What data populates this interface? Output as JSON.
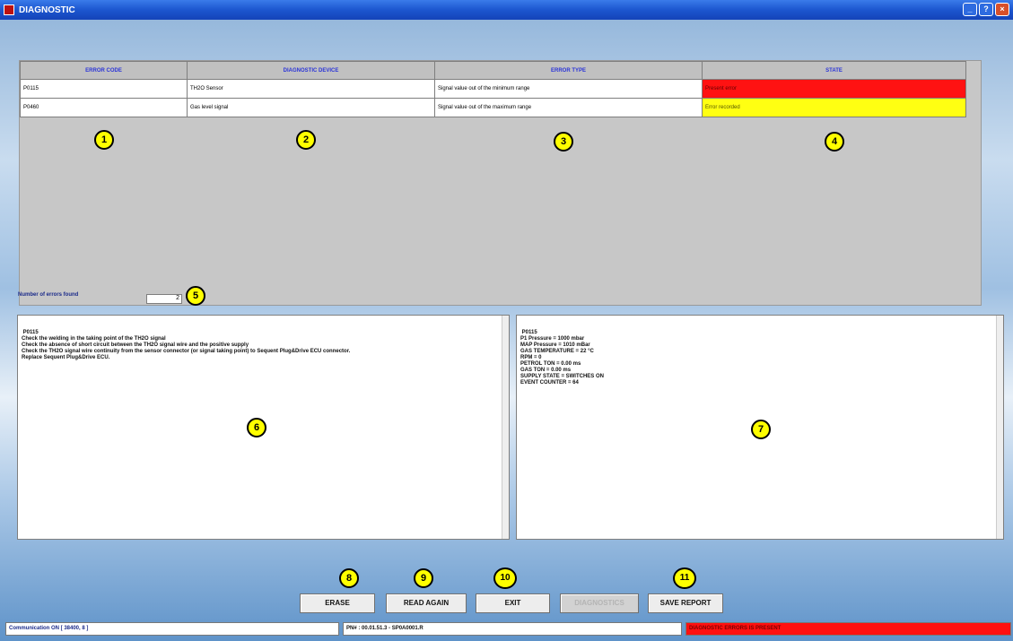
{
  "window": {
    "title": "DIAGNOSTIC"
  },
  "table": {
    "columns": [
      "ERROR CODE",
      "DIAGNOSTIC DEVICE",
      "ERROR TYPE",
      "STATE"
    ],
    "rows": [
      {
        "code": "P0115",
        "device": "TH2O Sensor",
        "type": "Signal value out of the minimum range",
        "state": "Present error",
        "state_color": "#ff1212"
      },
      {
        "code": "P0460",
        "device": "Gas level signal",
        "type": "Signal value out of the maximum range",
        "state": "Error recorded",
        "state_color": "#ffff12"
      }
    ]
  },
  "errors_found": {
    "label": "Number of errors found",
    "value": "2"
  },
  "description_text": " P0115 \nCheck the welding in the taking point of the TH2O signal\nCheck the absence of short circuit between the TH2O signal wire and the positive supply\nCheck the TH2O signal wire continuity from the sensor connector (or signal taking point) to Sequent Plug&Drive ECU connector.\nReplace Sequent Plug&Drive ECU.",
  "snapshot_text": " P0115 \nP1 Pressure = 1000 mbar\nMAP Pressure = 1010 mBar\nGAS TEMPERATURE = 22 °C\nRPM = 0\nPETROL TON = 0.00 ms\nGAS TON = 0.00 ms\nSUPPLY STATE = SWITCHES ON\nEVENT COUNTER = 64",
  "buttons": {
    "erase": "ERASE",
    "read_again": "READ AGAIN",
    "exit": "EXIT",
    "disabled": "DIAGNOSTICS",
    "save_report": "SAVE REPORT"
  },
  "markers": [
    "1",
    "2",
    "3",
    "4",
    "5",
    "6",
    "7",
    "8",
    "9",
    "10",
    "11"
  ],
  "status": {
    "comm": "Communication ON [ 38400, 8 ]",
    "pn": "PN# : 00.01.51.3 - SP0A0001.R",
    "alert": "DIAGNOSTIC ERRORS IS PRESENT"
  }
}
